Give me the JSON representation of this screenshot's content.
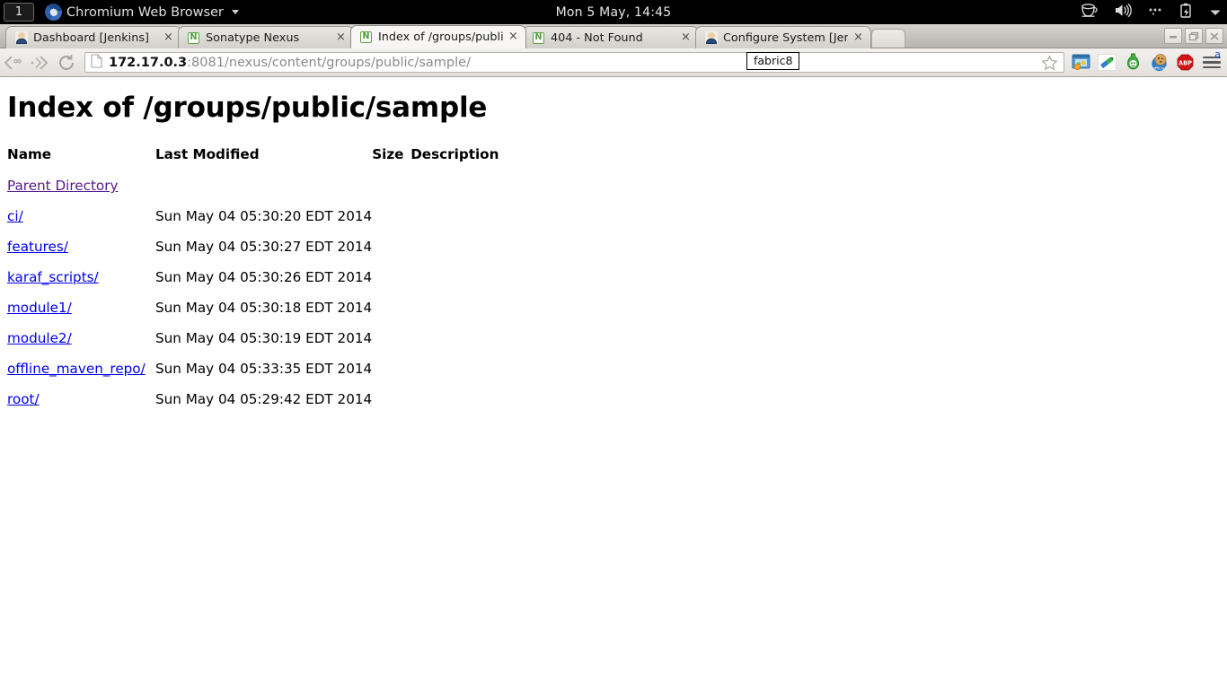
{
  "system_panel": {
    "workspace": "1",
    "app_menu_label": "Chromium Web Browser",
    "app_icon": "chromium-logo-icon",
    "menu_caret_icon": "chevron-down-icon",
    "clock": "Mon  5 May, 14:45",
    "tray_icons": [
      {
        "name": "coffee-cup-icon"
      },
      {
        "name": "volume-speaker-icon"
      },
      {
        "name": "three-dots-icon"
      },
      {
        "name": "battery-clipboard-icon"
      },
      {
        "name": "chevron-down-icon"
      }
    ]
  },
  "browser": {
    "tabs": [
      {
        "title": "Dashboard [Jenkins]",
        "favicon": "jenkins-butler-icon",
        "active": false,
        "close_label": "×"
      },
      {
        "title": "Sonatype Nexus",
        "favicon": "nexus-n-icon",
        "active": false,
        "close_label": "×"
      },
      {
        "title": "Index of /groups/publi",
        "favicon": "nexus-n-icon",
        "active": true,
        "close_label": "×"
      },
      {
        "title": "404 - Not Found",
        "favicon": "nexus-n-icon",
        "active": false,
        "close_label": "×"
      },
      {
        "title": "Configure System [Jenk",
        "favicon": "jenkins-butler-icon",
        "active": false,
        "close_label": "×"
      }
    ],
    "new_tab_label": "",
    "window_controls": [
      {
        "name": "minimize-button",
        "glyph": "—"
      },
      {
        "name": "restore-button",
        "glyph": "❐"
      },
      {
        "name": "close-button",
        "glyph": "✕"
      }
    ],
    "toolbar": {
      "back_icon": "back-arrow-icon",
      "forward_icon": "forward-arrow-icon",
      "reload_icon": "reload-icon",
      "page_icon": "page-document-icon",
      "url_host": "172.17.0.3",
      "url_rest": ":8081/nexus/content/groups/public/sample/",
      "url_full": "172.17.0.3:8081/nexus/content/groups/public/sample/",
      "bookmark_icon": "bookmark-star-icon",
      "tooltip": "fabric8",
      "extensions": [
        {
          "name": "screenshot-window-extension-icon"
        },
        {
          "name": "marker-pen-extension-icon"
        },
        {
          "name": "green-bottle-extension-icon"
        },
        {
          "name": "cookie-extension-icon"
        },
        {
          "name": "adblock-plus-extension-icon",
          "label": "ABP"
        }
      ],
      "menu_icon": "hamburger-menu-icon",
      "menu_badge": "a"
    }
  },
  "page": {
    "title": "Index of /groups/public/sample",
    "columns": [
      "Name",
      "Last Modified",
      "Size",
      "Description"
    ],
    "rows": [
      {
        "name": "Parent Directory",
        "modified": "",
        "size": "",
        "description": "",
        "visited": true
      },
      {
        "name": "ci/",
        "modified": "Sun May 04 05:30:20 EDT 2014",
        "size": "",
        "description": "",
        "visited": false
      },
      {
        "name": "features/",
        "modified": "Sun May 04 05:30:27 EDT 2014",
        "size": "",
        "description": "",
        "visited": false
      },
      {
        "name": "karaf_scripts/",
        "modified": "Sun May 04 05:30:26 EDT 2014",
        "size": "",
        "description": "",
        "visited": false
      },
      {
        "name": "module1/",
        "modified": "Sun May 04 05:30:18 EDT 2014",
        "size": "",
        "description": "",
        "visited": false
      },
      {
        "name": "module2/",
        "modified": "Sun May 04 05:30:19 EDT 2014",
        "size": "",
        "description": "",
        "visited": false
      },
      {
        "name": "offline_maven_repo/",
        "modified": "Sun May 04 05:33:35 EDT 2014",
        "size": "",
        "description": "",
        "visited": false
      },
      {
        "name": "root/",
        "modified": "Sun May 04 05:29:42 EDT 2014",
        "size": "",
        "description": "",
        "visited": false
      }
    ]
  },
  "colors": {
    "link": "#0000ee",
    "visited_link": "#551a8b",
    "panel_bg": "#000000",
    "toolbar_bg": "#e9e6e2",
    "nexus_green": "#5aa73c",
    "abp_red": "#d11414"
  }
}
